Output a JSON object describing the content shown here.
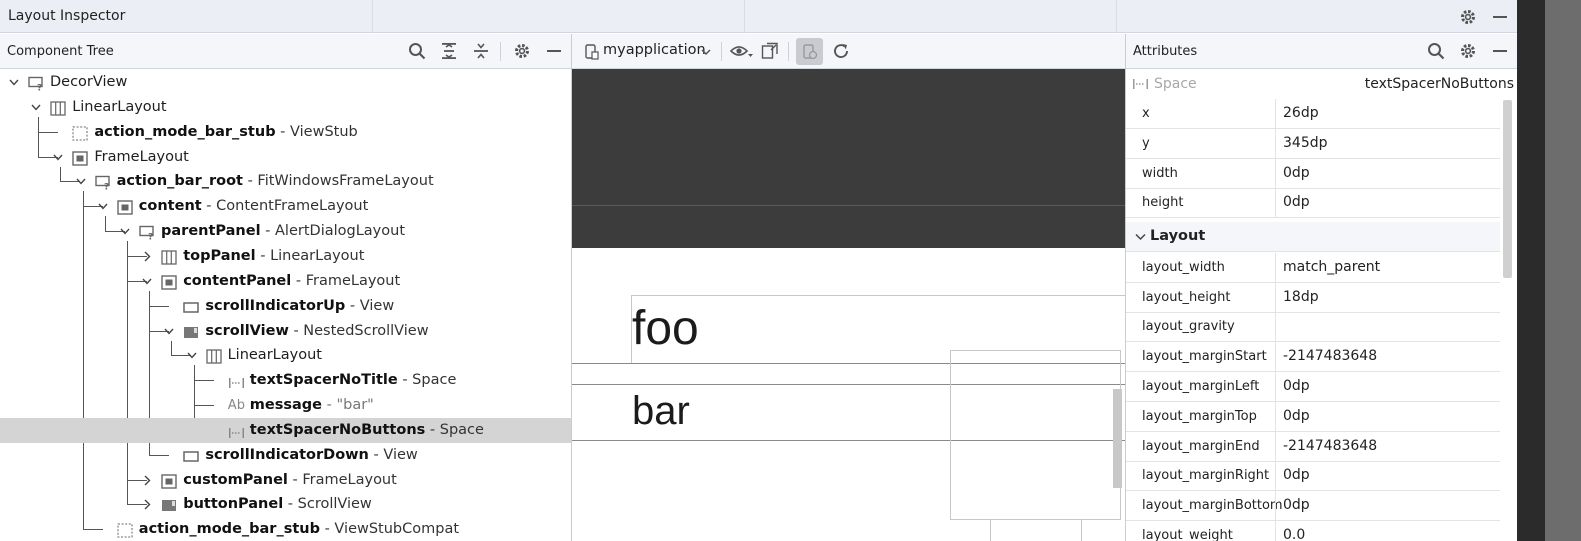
{
  "window": {
    "title": "Layout Inspector"
  },
  "component_tree": {
    "title": "Component Tree",
    "nodes": [
      {
        "name": "DecorView",
        "type": "",
        "depth": 0,
        "icon": "unknown-view-icon",
        "expanded": true
      },
      {
        "name": "LinearLayout",
        "type": "",
        "depth": 1,
        "icon": "linear-layout-icon",
        "expanded": true
      },
      {
        "name": "action_mode_bar_stub",
        "type": " - ViewStub",
        "depth": 2,
        "icon": "viewstub-icon"
      },
      {
        "name": "FrameLayout",
        "type": "",
        "depth": 2,
        "icon": "frame-layout-icon",
        "expanded": true
      },
      {
        "name": "action_bar_root",
        "type": " - FitWindowsFrameLayout",
        "depth": 3,
        "icon": "unknown-view-icon",
        "expanded": true
      },
      {
        "name": "content",
        "type": " - ContentFrameLayout",
        "depth": 4,
        "icon": "frame-layout-icon",
        "expanded": true
      },
      {
        "name": "parentPanel",
        "type": " - AlertDialogLayout",
        "depth": 5,
        "icon": "unknown-view-icon",
        "expanded": true
      },
      {
        "name": "topPanel",
        "type": " - LinearLayout",
        "depth": 6,
        "icon": "linear-layout-icon",
        "expanded": false
      },
      {
        "name": "contentPanel",
        "type": " - FrameLayout",
        "depth": 6,
        "icon": "frame-layout-icon",
        "expanded": true
      },
      {
        "name": "scrollIndicatorUp",
        "type": " - View",
        "depth": 7,
        "icon": "view-icon"
      },
      {
        "name": "scrollView",
        "type": " - NestedScrollView",
        "depth": 7,
        "icon": "scroll-view-icon",
        "expanded": true
      },
      {
        "name": "LinearLayout",
        "type": "",
        "depth": 8,
        "icon": "linear-layout-icon",
        "expanded": true
      },
      {
        "name": "textSpacerNoTitle",
        "type": " - Space",
        "depth": 9,
        "icon": "space-icon"
      },
      {
        "name": "message",
        "type": " - \"bar\"",
        "depth": 9,
        "icon": "text-view-icon",
        "prefix": "Ab"
      },
      {
        "name": "textSpacerNoButtons",
        "type": " - Space",
        "depth": 9,
        "icon": "space-icon",
        "selected": true
      },
      {
        "name": "scrollIndicatorDown",
        "type": " - View",
        "depth": 7,
        "icon": "view-icon"
      },
      {
        "name": "customPanel",
        "type": " - FrameLayout",
        "depth": 6,
        "icon": "frame-layout-icon",
        "expanded": false
      },
      {
        "name": "buttonPanel",
        "type": " - ScrollView",
        "depth": 6,
        "icon": "scroll-view-icon",
        "expanded": false
      },
      {
        "name": "action_mode_bar_stub",
        "type": " - ViewStubCompat",
        "depth": 4,
        "icon": "viewstub-icon"
      }
    ]
  },
  "device_view": {
    "process": "myapplication",
    "content": {
      "title_text": "foo",
      "message_text": "bar"
    }
  },
  "attributes": {
    "title": "Attributes",
    "selected_type": "Space",
    "selected_id": "textSpacerNoButtons",
    "rows": [
      {
        "key": "x",
        "value": "26dp"
      },
      {
        "key": "y",
        "value": "345dp"
      },
      {
        "key": "width",
        "value": "0dp"
      },
      {
        "key": "height",
        "value": "0dp"
      }
    ],
    "section": "Layout",
    "layout_rows": [
      {
        "key": "layout_width",
        "value": "match_parent"
      },
      {
        "key": "layout_height",
        "value": "18dp"
      },
      {
        "key": "layout_gravity",
        "value": ""
      },
      {
        "key": "layout_marginStart",
        "value": "-2147483648"
      },
      {
        "key": "layout_marginLeft",
        "value": "0dp"
      },
      {
        "key": "layout_marginTop",
        "value": "0dp"
      },
      {
        "key": "layout_marginEnd",
        "value": "-2147483648"
      },
      {
        "key": "layout_marginRight",
        "value": "0dp"
      },
      {
        "key": "layout_marginBottom",
        "value": "0dp"
      },
      {
        "key": "layout_weight",
        "value": "0.0"
      }
    ]
  },
  "colors": {
    "selected_row": "#d4d4d4",
    "device_dark": "#3c3c3c",
    "panel_header": "#f5f6fa"
  }
}
